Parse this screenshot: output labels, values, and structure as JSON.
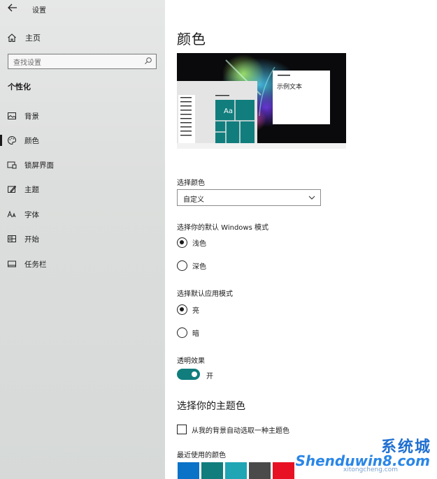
{
  "window": {
    "title": "设置"
  },
  "sidebar": {
    "home_label": "主页",
    "search_placeholder": "查找设置",
    "section_label": "个性化",
    "items": [
      {
        "label": "背景",
        "icon": "image-icon"
      },
      {
        "label": "颜色",
        "icon": "palette-icon",
        "active": true
      },
      {
        "label": "锁屏界面",
        "icon": "lock-screen-icon"
      },
      {
        "label": "主题",
        "icon": "theme-icon"
      },
      {
        "label": "字体",
        "icon": "font-icon"
      },
      {
        "label": "开始",
        "icon": "start-icon"
      },
      {
        "label": "任务栏",
        "icon": "taskbar-icon"
      }
    ]
  },
  "main": {
    "title": "颜色",
    "preview": {
      "tile_text": "Aa",
      "sample_text": "示例文本"
    },
    "choose_color": {
      "label": "选择颜色",
      "value": "自定义"
    },
    "windows_mode": {
      "label": "选择你的默认 Windows 模式",
      "options": [
        "浅色",
        "深色"
      ],
      "selected": 0
    },
    "app_mode": {
      "label": "选择默认应用模式",
      "options": [
        "亮",
        "暗"
      ],
      "selected": 0
    },
    "transparency": {
      "label": "透明效果",
      "state_text": "开",
      "on": true
    },
    "accent": {
      "title": "选择你的主题色",
      "auto_pick_label": "从我的背景自动选取一种主题色",
      "recent_label": "最近使用的颜色",
      "recent_colors": [
        "#0a72c7",
        "#117d7d",
        "#1fa5b4",
        "#4a4a4a",
        "#e81123"
      ]
    }
  },
  "colors": {
    "accent": "#117d7d",
    "sidebar_bg": "#dcdedd"
  },
  "watermark": {
    "cn": "系统城",
    "en": "Shenduwin8.com",
    "small": "xitongcheng.com"
  }
}
